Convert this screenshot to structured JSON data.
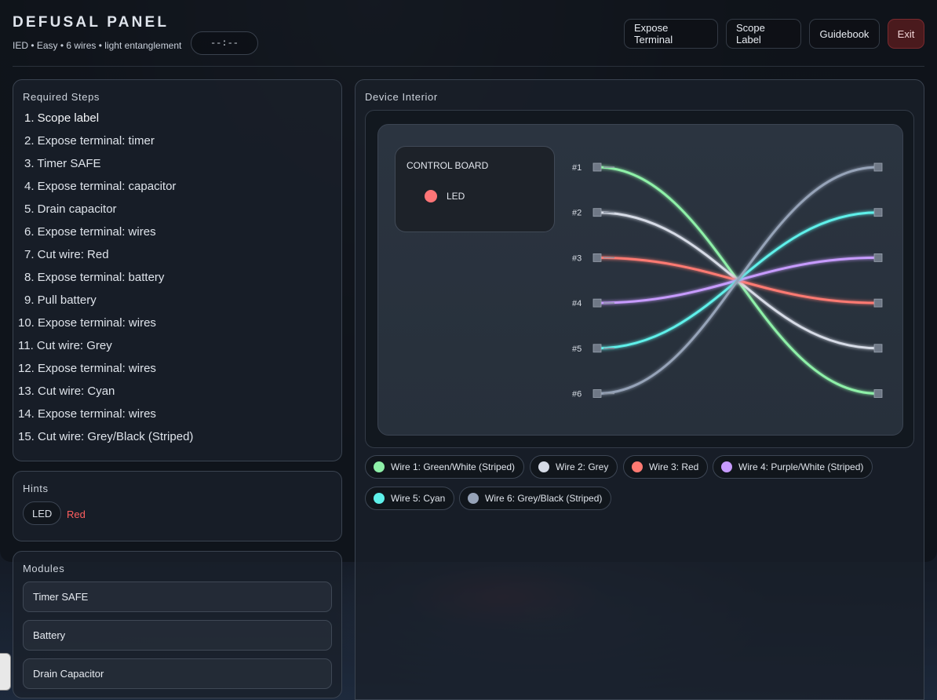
{
  "header": {
    "title": "DEFUSAL PANEL",
    "subtitle": "IED • Easy • 6 wires • light entanglement",
    "timer": "--:--",
    "buttons": {
      "expose_terminal": "Expose Terminal",
      "scope_label": "Scope Label",
      "guidebook": "Guidebook",
      "exit": "Exit"
    }
  },
  "steps": {
    "title": "Required Steps",
    "items": [
      "1. Scope label",
      "2. Expose terminal: timer",
      "3. Timer SAFE",
      "4. Expose terminal: capacitor",
      "5. Drain capacitor",
      "6. Expose terminal: wires",
      "7. Cut wire: Red",
      "8. Expose terminal: battery",
      "9. Pull battery",
      "10. Expose terminal: wires",
      "11. Cut wire: Grey",
      "12. Expose terminal: wires",
      "13. Cut wire: Cyan",
      "14. Expose terminal: wires",
      "15. Cut wire: Grey/Black (Striped)"
    ]
  },
  "hints": {
    "title": "Hints",
    "chip": "LED",
    "value": "Red",
    "value_color": "#ff5f5f"
  },
  "modules": {
    "title": "Modules",
    "items": [
      "Timer SAFE",
      "Battery",
      "Drain Capacitor"
    ]
  },
  "interior": {
    "title": "Device Interior",
    "control_board": {
      "title": "CONTROL BOARD",
      "led_label": "LED",
      "led_color": "#ff7577"
    },
    "terminals": [
      "#1",
      "#2",
      "#3",
      "#4",
      "#5",
      "#6"
    ],
    "wires": [
      {
        "label": "Wire 1: Green/White (Striped)",
        "color": "#8ef0a8",
        "from": 1,
        "to": 6
      },
      {
        "label": "Wire 2: Grey",
        "color": "#d6dbe6",
        "from": 2,
        "to": 5
      },
      {
        "label": "Wire 3: Red",
        "color": "#ff7a72",
        "from": 3,
        "to": 4
      },
      {
        "label": "Wire 4: Purple/White (Striped)",
        "color": "#c79bff",
        "from": 4,
        "to": 3
      },
      {
        "label": "Wire 5: Cyan",
        "color": "#5ef0ea",
        "from": 5,
        "to": 2
      },
      {
        "label": "Wire 6: Grey/Black (Striped)",
        "color": "#96a3b8",
        "from": 6,
        "to": 1
      }
    ]
  }
}
